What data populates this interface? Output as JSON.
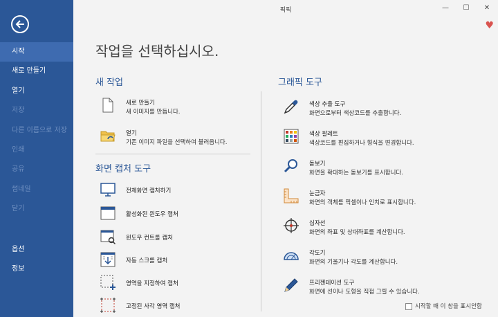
{
  "window": {
    "title": "픽픽",
    "minimize": "—",
    "maximize": "☐",
    "close": "✕"
  },
  "sidebar": {
    "items": [
      {
        "label": "시작",
        "state": "active"
      },
      {
        "label": "새로 만들기",
        "state": "normal"
      },
      {
        "label": "열기",
        "state": "normal"
      },
      {
        "label": "저장",
        "state": "disabled"
      },
      {
        "label": "다른 이름으로 저장",
        "state": "disabled"
      },
      {
        "label": "인쇄",
        "state": "disabled"
      },
      {
        "label": "공유",
        "state": "disabled"
      },
      {
        "label": "썸네일",
        "state": "disabled"
      },
      {
        "label": "닫기",
        "state": "disabled"
      }
    ],
    "bottom_items": [
      {
        "label": "옵션"
      },
      {
        "label": "정보"
      }
    ]
  },
  "main": {
    "title": "작업을 선택하십시오.",
    "new_task": {
      "title": "새 작업",
      "items": [
        {
          "title": "새로 만들기",
          "desc": "새 이미지를 만듭니다."
        },
        {
          "title": "열기",
          "desc": "기존 이미지 파일을 선택하여 불러옵니다."
        }
      ]
    },
    "capture": {
      "title": "화면 캡처 도구",
      "items": [
        {
          "label": "전체화면 캡처하기"
        },
        {
          "label": "활성화된 윈도우 캡처"
        },
        {
          "label": "윈도우 컨트롤 캡처"
        },
        {
          "label": "자동 스크롤 캡처"
        },
        {
          "label": "영역을 지정하여 캡처"
        },
        {
          "label": "고정된 사각 영역 캡처"
        }
      ]
    },
    "graphic": {
      "title": "그래픽 도구",
      "items": [
        {
          "title": "색상 추출 도구",
          "desc": "화면으로부터 색상코드를 추출합니다."
        },
        {
          "title": "색상 팔레트",
          "desc": "색상코드를 편집하거나 형식을 변경합니다."
        },
        {
          "title": "돋보기",
          "desc": "화면을 확대하는 돋보기를 표시합니다."
        },
        {
          "title": "눈금자",
          "desc": "화면의 객체를 픽셀이나 인치로 표시합니다."
        },
        {
          "title": "십자선",
          "desc": "화면의 좌표 및 상대좌표를 계산합니다."
        },
        {
          "title": "각도기",
          "desc": "화면의 기울기나 각도를 계산합니다."
        },
        {
          "title": "프리젠테이션 도구",
          "desc": "화면에 선이나 도형을 직접 그릴 수 있습니다."
        }
      ]
    },
    "dont_show": "시작할 때 이 창을 표시안함"
  },
  "colors": {
    "sidebar": "#2b5797",
    "sidebar_active": "#3e6bb0",
    "accent": "#2b5797",
    "heart": "#d9534f"
  }
}
